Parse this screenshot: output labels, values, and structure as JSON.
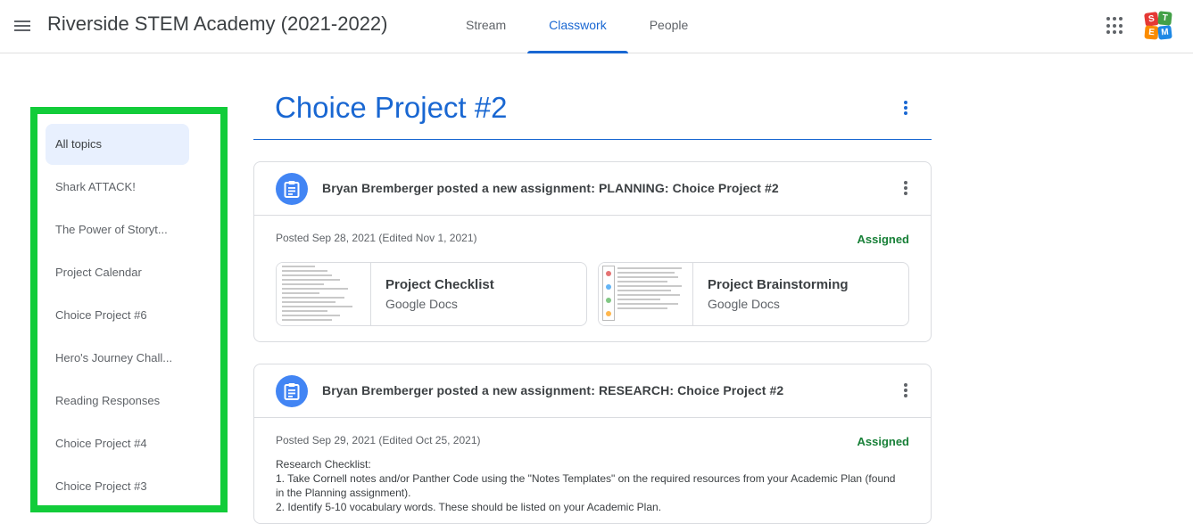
{
  "header": {
    "class_title": "Riverside STEM Academy (2021-2022)",
    "tabs": [
      {
        "label": "Stream"
      },
      {
        "label": "Classwork"
      },
      {
        "label": "People"
      }
    ],
    "avatar_letters": [
      "S",
      "T",
      "E",
      "M"
    ]
  },
  "sidebar": {
    "items": [
      {
        "label": "All topics"
      },
      {
        "label": "Shark ATTACK!"
      },
      {
        "label": "The Power of Storyt..."
      },
      {
        "label": "Project Calendar"
      },
      {
        "label": "Choice Project #6"
      },
      {
        "label": "Hero's Journey Chall..."
      },
      {
        "label": "Reading Responses"
      },
      {
        "label": "Choice Project #4"
      },
      {
        "label": "Choice Project #3"
      }
    ]
  },
  "main": {
    "topic_title": "Choice Project #2",
    "assignments": [
      {
        "title": "Bryan Bremberger posted a new assignment: PLANNING: Choice Project #2",
        "posted": "Posted Sep 28, 2021 (Edited Nov 1, 2021)",
        "status": "Assigned",
        "attachments": [
          {
            "title": "Project Checklist",
            "type": "Google Docs"
          },
          {
            "title": "Project Brainstorming",
            "type": "Google Docs"
          }
        ]
      },
      {
        "title": "Bryan Bremberger posted a new assignment: RESEARCH: Choice Project #2",
        "posted": "Posted Sep 29, 2021 (Edited Oct 25, 2021)",
        "status": "Assigned",
        "description": [
          "Research Checklist:",
          "1. Take Cornell notes and/or Panther Code using the \"Notes Templates\" on the required resources from your Academic Plan (found in the Planning assignment).",
          "2. Identify 5-10 vocabulary words.  These should be listed on your Academic Plan."
        ]
      }
    ]
  },
  "colors": {
    "accent": "#1967d2",
    "sidebar_highlight_border": "#12cc3a",
    "status_green": "#188038",
    "assignment_icon": "#4285f4"
  }
}
